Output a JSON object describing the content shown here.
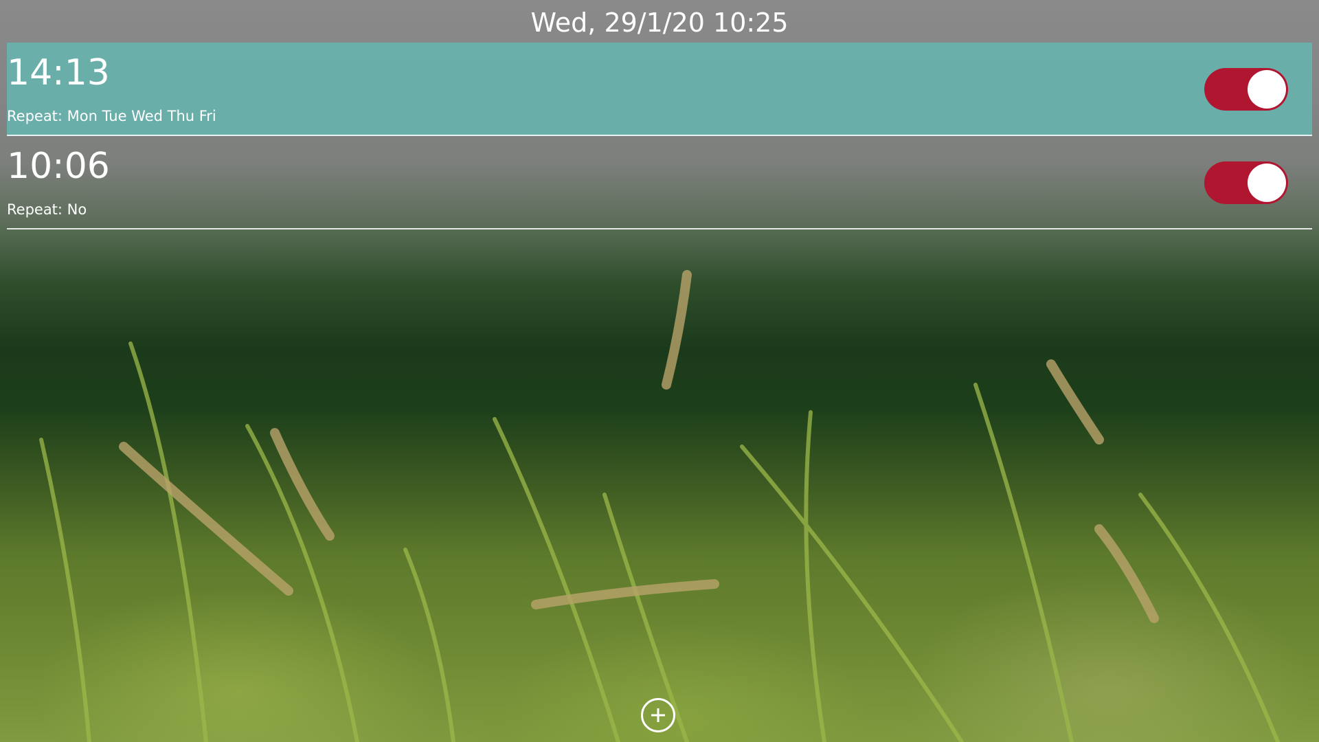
{
  "header": {
    "datetime": "Wed, 29/1/20 10:25"
  },
  "alarms": [
    {
      "time": "14:13",
      "repeat": "Repeat: Mon Tue Wed Thu Fri",
      "enabled": true,
      "selected": true
    },
    {
      "time": "10:06",
      "repeat": "Repeat: No",
      "enabled": true,
      "selected": false
    }
  ],
  "footer": {
    "add_icon": "plus-circle-icon"
  },
  "colors": {
    "selected_row": "#68b2ae",
    "toggle_on": "#b0162f",
    "text": "#ffffff"
  }
}
